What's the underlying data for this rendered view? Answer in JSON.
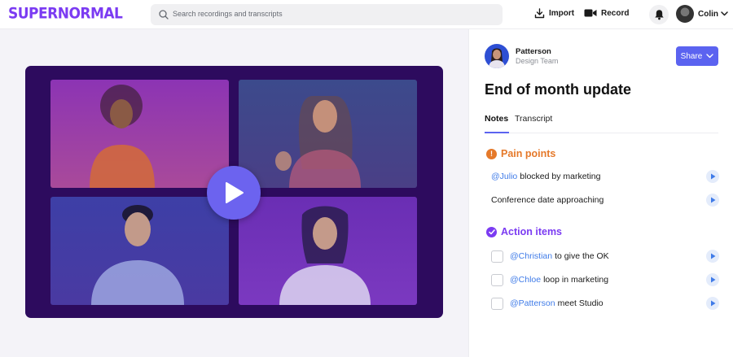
{
  "header": {
    "logo": "SUPERNORMAL",
    "search_placeholder": "Search recordings and transcripts",
    "import_label": "Import",
    "record_label": "Record",
    "user_name": "Colin"
  },
  "recording": {
    "owner_name": "Patterson",
    "owner_team": "Design Team",
    "share_label": "Share",
    "title": "End of month update"
  },
  "tabs": [
    {
      "label": "Notes",
      "active": true
    },
    {
      "label": "Transcript",
      "active": false
    }
  ],
  "pain_points": {
    "heading": "Pain points",
    "items": [
      {
        "mention": "@Julio",
        "text": "blocked by marketing"
      },
      {
        "mention": "",
        "text": "Conference date approaching"
      }
    ]
  },
  "action_items": {
    "heading": "Action items",
    "items": [
      {
        "mention": "@Christian",
        "text": "to give the OK",
        "checked": false
      },
      {
        "mention": "@Chloe",
        "text": "loop in marketing",
        "checked": false
      },
      {
        "mention": "@Patterson",
        "text": "meet Studio",
        "checked": false
      }
    ]
  },
  "colors": {
    "brand": "#7b3bf2",
    "accent": "#5b63f0",
    "pain": "#e5792a",
    "mention": "#3f7be8"
  }
}
